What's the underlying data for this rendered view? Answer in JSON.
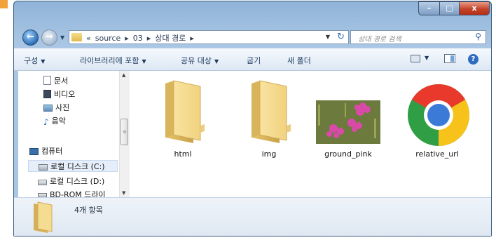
{
  "window": {
    "controls": {
      "minimize": "–",
      "maximize": "□",
      "close": "x"
    }
  },
  "nav": {
    "back": "←",
    "forward": "→"
  },
  "address": {
    "segments": [
      "«",
      "source",
      "▸",
      "03",
      "▸",
      "상대 경로",
      "▸"
    ]
  },
  "search": {
    "placeholder": "상대 경로 검색"
  },
  "toolbar": {
    "organize": "구성",
    "include_library": "라이브러리에 포함",
    "share_with": "공유 대상",
    "burn": "굽기",
    "new_folder": "새 폴더",
    "help": "?"
  },
  "sidebar": {
    "items": [
      {
        "label": "문서",
        "icon": "documents-icon"
      },
      {
        "label": "비디오",
        "icon": "videos-icon"
      },
      {
        "label": "사진",
        "icon": "pictures-icon"
      },
      {
        "label": "음악",
        "icon": "music-icon"
      },
      {
        "label": "컴퓨터",
        "icon": "computer-icon"
      },
      {
        "label": "로컬 디스크 (C:)",
        "icon": "drive-icon"
      },
      {
        "label": "로컬 디스크 (D:)",
        "icon": "drive-icon"
      },
      {
        "label": "BD-ROM 드라이",
        "icon": "optical-drive-icon"
      }
    ],
    "selected": "로컬 디스크 (C:)"
  },
  "files": [
    {
      "name": "html",
      "type": "folder"
    },
    {
      "name": "img",
      "type": "folder"
    },
    {
      "name": "ground_pink",
      "type": "image"
    },
    {
      "name": "relative_url",
      "type": "chrome-shortcut"
    }
  ],
  "status": {
    "count_text": "4개 항목"
  },
  "colors": {
    "corner_accent": "#f3a13a",
    "frame": "#a9c6e4",
    "close_button": "#c3442a"
  }
}
